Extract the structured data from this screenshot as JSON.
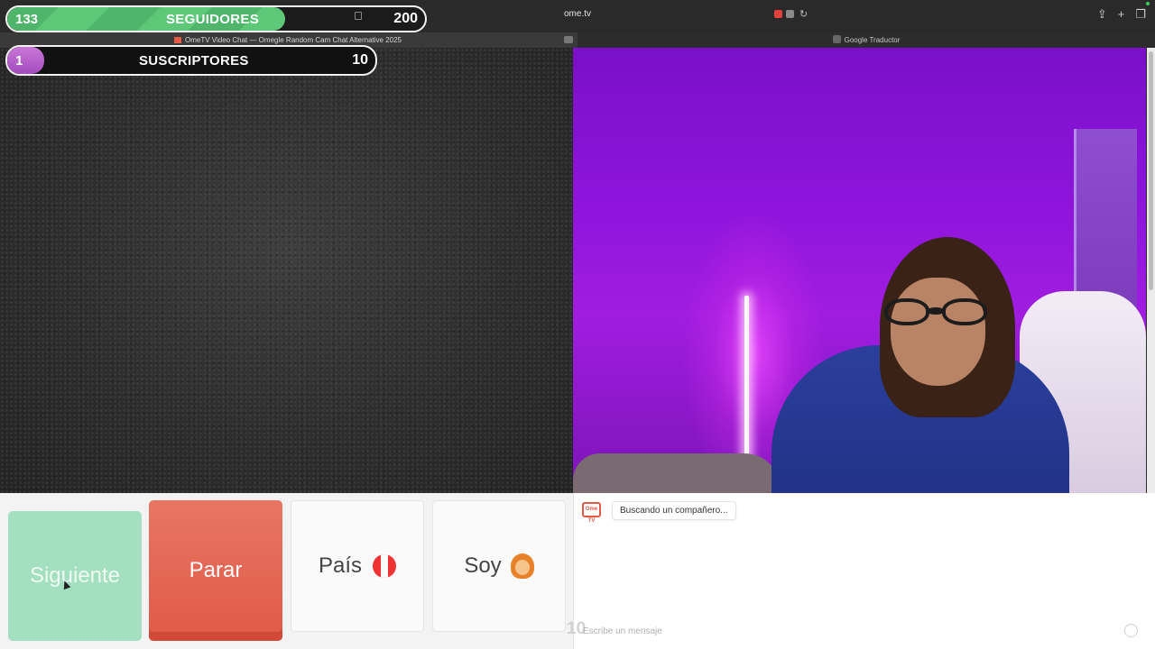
{
  "browser": {
    "url": "ome.tv",
    "left_tab_title": "OmeTV Video Chat — Omegle Random Cam Chat Alternative 2025",
    "right_tab_title": "Google Traductor"
  },
  "overlay": {
    "followers": {
      "current": "133",
      "label": "SEGUIDORES",
      "goal": "200",
      "progress": 0.665
    },
    "subscribers": {
      "current": "1",
      "label": "SUSCRIPTORES",
      "goal": "10",
      "progress": 0.1
    }
  },
  "controls": {
    "next_label": "Siguiente",
    "stop_label": "Parar",
    "country_label": "País",
    "soy_label": "Soy"
  },
  "chat": {
    "logo_text": "Ome TV",
    "status_message": "Buscando un compañero...",
    "input_placeholder": "Escribe un mensaje",
    "overlay_number": "10"
  },
  "colors": {
    "next": "#a4dfc0",
    "stop": "#e05a47",
    "follow_bar": "#5cc878",
    "sub_bar": "#b55fcb",
    "self_bg": "#8e14dc"
  },
  "icons": {
    "flag": "peru-flag-icon",
    "soy": "woman-emoji-icon",
    "smile": "smile-icon"
  }
}
